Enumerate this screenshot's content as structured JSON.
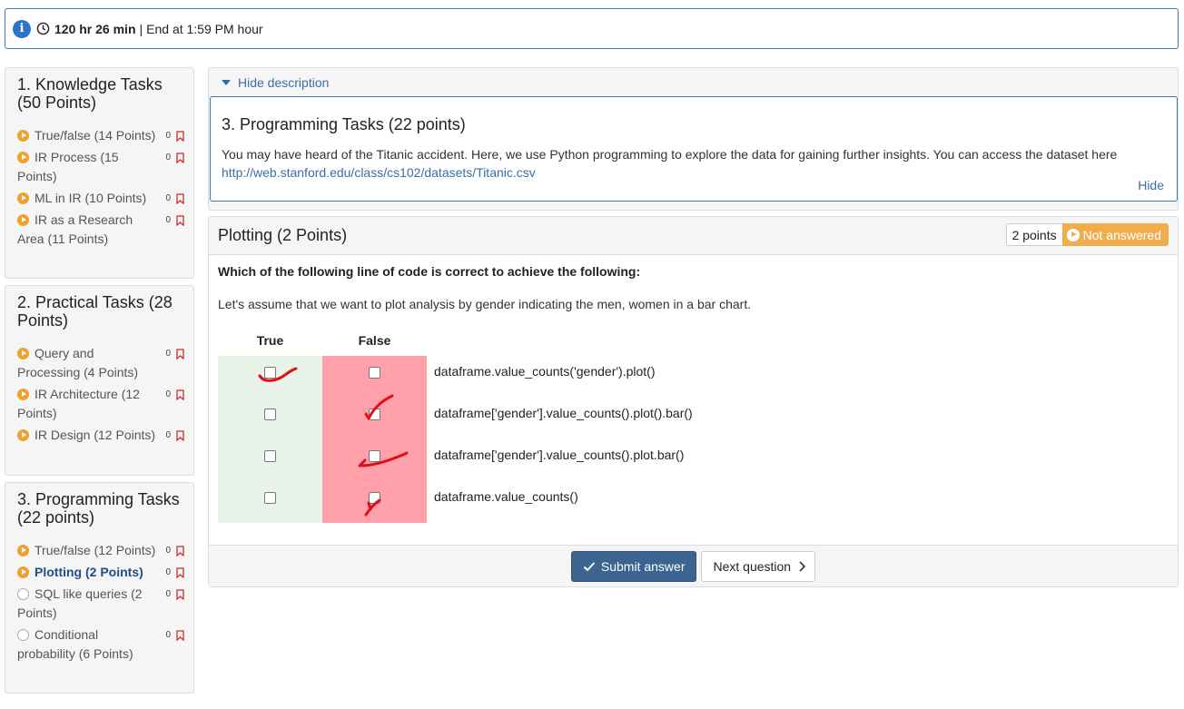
{
  "timer": {
    "duration": "120 hr 26 min",
    "separator": "|",
    "end_text": "End at 1:59 PM hour"
  },
  "sidebar": {
    "sections": [
      {
        "title": "1. Knowledge Tasks (50 Points)",
        "items": [
          {
            "label": "True/false (14 Points)",
            "count": "0",
            "state": "started"
          },
          {
            "label": "IR Process (15 Points)",
            "count": "0",
            "state": "started"
          },
          {
            "label": "ML in IR (10 Points)",
            "count": "0",
            "state": "started"
          },
          {
            "label": "IR as a Research Area (11 Points)",
            "count": "0",
            "state": "started"
          }
        ]
      },
      {
        "title": "2. Practical Tasks (28 Points)",
        "items": [
          {
            "label": "Query and Processing (4 Points)",
            "count": "0",
            "state": "started"
          },
          {
            "label": "IR Architecture (12 Points)",
            "count": "0",
            "state": "started"
          },
          {
            "label": "IR Design (12 Points)",
            "count": "0",
            "state": "started"
          }
        ]
      },
      {
        "title": "3. Programming Tasks (22 points)",
        "items": [
          {
            "label": "True/false (12 Points)",
            "count": "0",
            "state": "started"
          },
          {
            "label": "Plotting (2 Points)",
            "count": "0",
            "state": "active"
          },
          {
            "label": "SQL like queries (2 Points)",
            "count": "0",
            "state": "empty"
          },
          {
            "label": "Conditional probability (6 Points)",
            "count": "0",
            "state": "empty"
          }
        ]
      }
    ]
  },
  "description": {
    "toggle_label": "Hide description",
    "title": "3. Programming Tasks (22 points)",
    "text": "You may have heard of the Titanic accident. Here, we use Python programming to explore the data for gaining further insights. You can access the dataset here",
    "link": "http://web.stanford.edu/class/cs102/datasets/Titanic.csv",
    "hide_label": "Hide"
  },
  "question": {
    "title": "Plotting (2 Points)",
    "points_badge": "2 points",
    "status_badge": "Not answered",
    "prompt": "Which of the following line of code is correct to achieve the following:",
    "text": "Let's assume that we want to plot analysis by gender indicating the men, women in a bar chart.",
    "columns": {
      "true": "True",
      "false": "False"
    },
    "options": [
      "dataframe.value_counts('gender').plot()",
      "dataframe['gender'].value_counts().plot().bar()",
      "dataframe['gender'].value_counts().plot.bar()",
      "dataframe.value_counts()"
    ],
    "submit_label": "Submit answer",
    "next_label": "Next question"
  },
  "colors": {
    "accent": "#3c6491",
    "warning": "#f0ad4e",
    "true_column": "#e9f3e9",
    "false_column": "#ffa0aa",
    "ink": "#e0101a"
  }
}
